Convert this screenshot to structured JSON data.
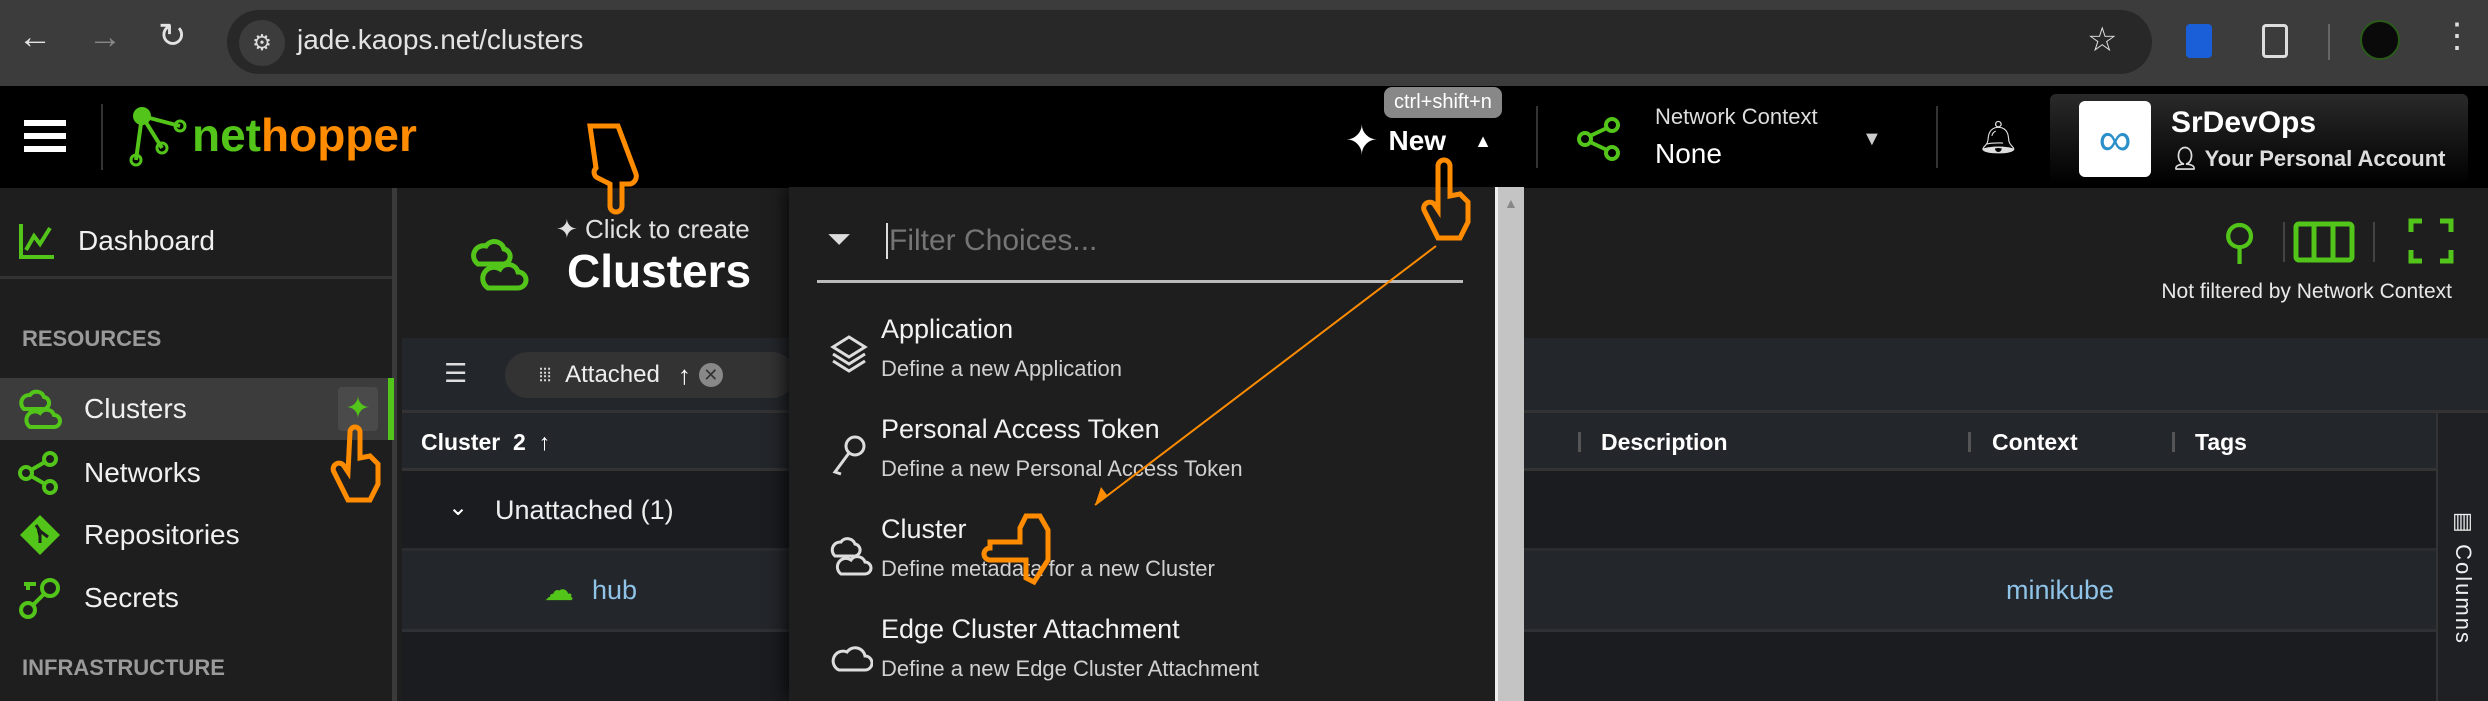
{
  "browser": {
    "url": "jade.kaops.net/clusters"
  },
  "header": {
    "logo_text_a": "net",
    "logo_text_b": "hopper",
    "new_shortcut": "ctrl+shift+n",
    "new_label": "New",
    "network_context_label": "Network Context",
    "network_context_value": "None",
    "account_name": "SrDevOps",
    "account_sub": "Your Personal Account"
  },
  "sidebar": {
    "dashboard": "Dashboard",
    "section_resources": "RESOURCES",
    "items": [
      {
        "label": "Clusters"
      },
      {
        "label": "Networks"
      },
      {
        "label": "Repositories"
      },
      {
        "label": "Secrets"
      }
    ],
    "section_infrastructure": "INFRASTRUCTURE"
  },
  "page": {
    "create_hint": "Click to create",
    "title": "Clusters",
    "filter_status": "Not filtered by Network Context",
    "group_chip": "Attached",
    "columns": {
      "cluster": "Cluster",
      "cluster_sort_index": "2",
      "description": "Description",
      "context": "Context",
      "tags": "Tags"
    },
    "group_row": "Unattached (1)",
    "rows": [
      {
        "name": "hub",
        "context": "minikube"
      }
    ],
    "columns_panel": "Columns"
  },
  "dropdown": {
    "placeholder": "Filter Choices...",
    "items": [
      {
        "title": "Application",
        "desc": "Define a new Application"
      },
      {
        "title": "Personal Access Token",
        "desc": "Define a new Personal Access Token"
      },
      {
        "title": "Cluster",
        "desc": "Define metadata for a new Cluster"
      },
      {
        "title": "Edge Cluster Attachment",
        "desc": "Define a new Edge Cluster Attachment"
      }
    ]
  },
  "colors": {
    "accent": "#52c41a",
    "brand_orange": "#ff8c00",
    "link": "#8fc3e8"
  }
}
